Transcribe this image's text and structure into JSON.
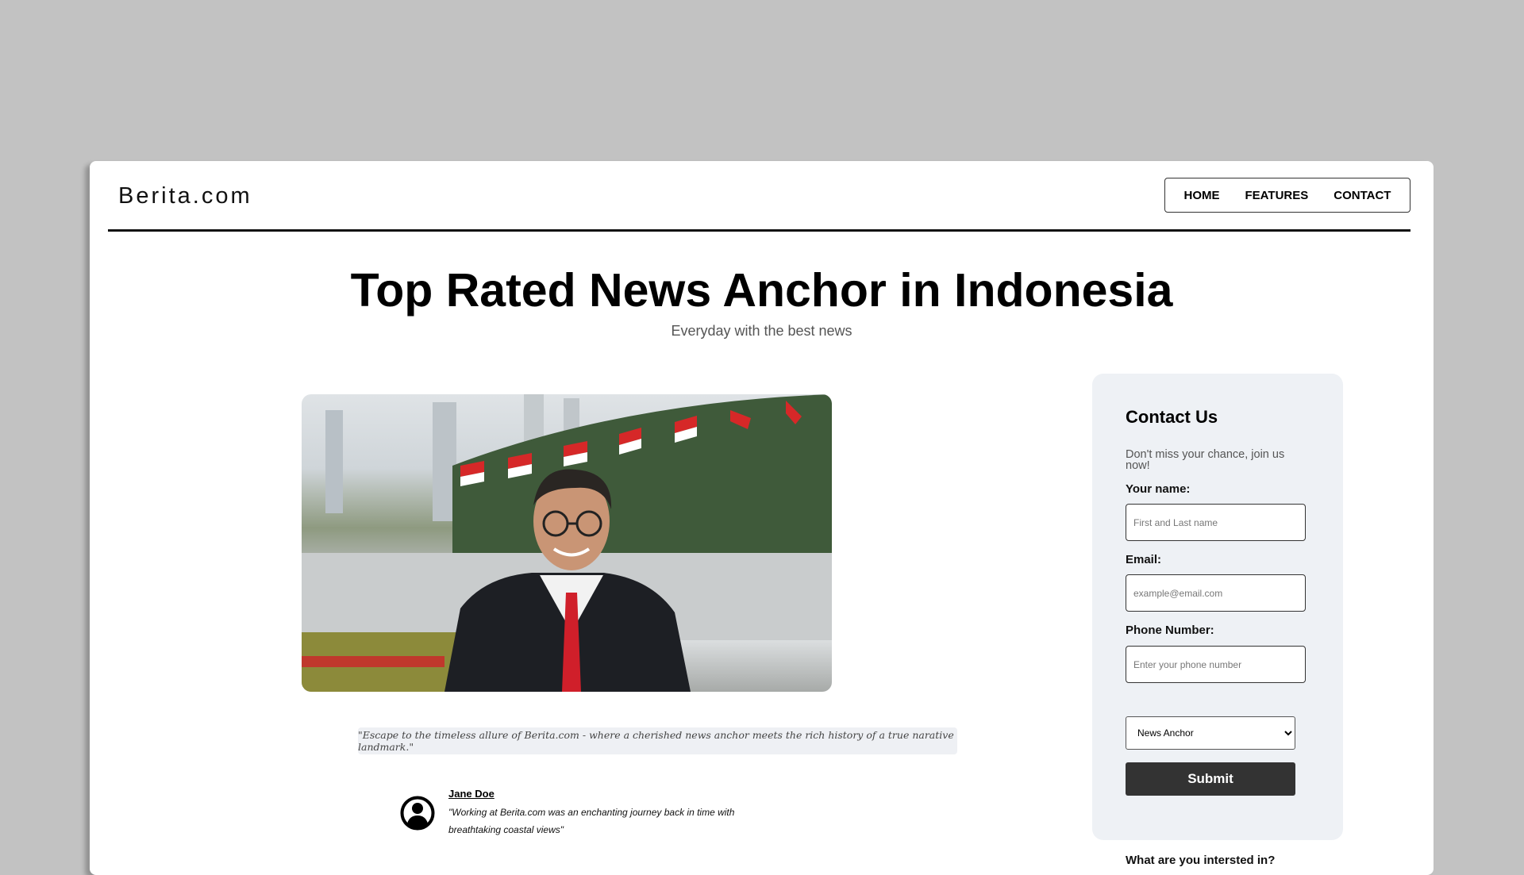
{
  "header": {
    "logo": "Berita.com",
    "nav": [
      {
        "label": "HOME"
      },
      {
        "label": "FEATURES"
      },
      {
        "label": "CONTACT"
      }
    ]
  },
  "hero": {
    "title": "Top Rated News Anchor in Indonesia",
    "subtitle": "Everyday with the best news"
  },
  "quote": "\"Escape to the timeless allure of Berita.com - where a cherished news anchor meets the rich history of a true narative landmark.\"",
  "testimonial": {
    "name": "Jane Doe",
    "text": "\"Working at Berita.com was an enchanting journey back in time with breathtaking coastal views\""
  },
  "contact": {
    "heading": "Contact Us",
    "description": "Don't miss your chance, join us now!",
    "name_label": "Your name:",
    "name_placeholder": "First and Last name",
    "email_label": "Email:",
    "email_placeholder": "example@email.com",
    "phone_label": "Phone Number:",
    "phone_placeholder": "Enter your phone number",
    "interest_label": "What are you intersted in?",
    "interest_value": "News Anchor",
    "submit": "Submit"
  },
  "colors": {
    "panel": "#eef1f5",
    "button": "#333333",
    "flag_red": "#d62828"
  }
}
